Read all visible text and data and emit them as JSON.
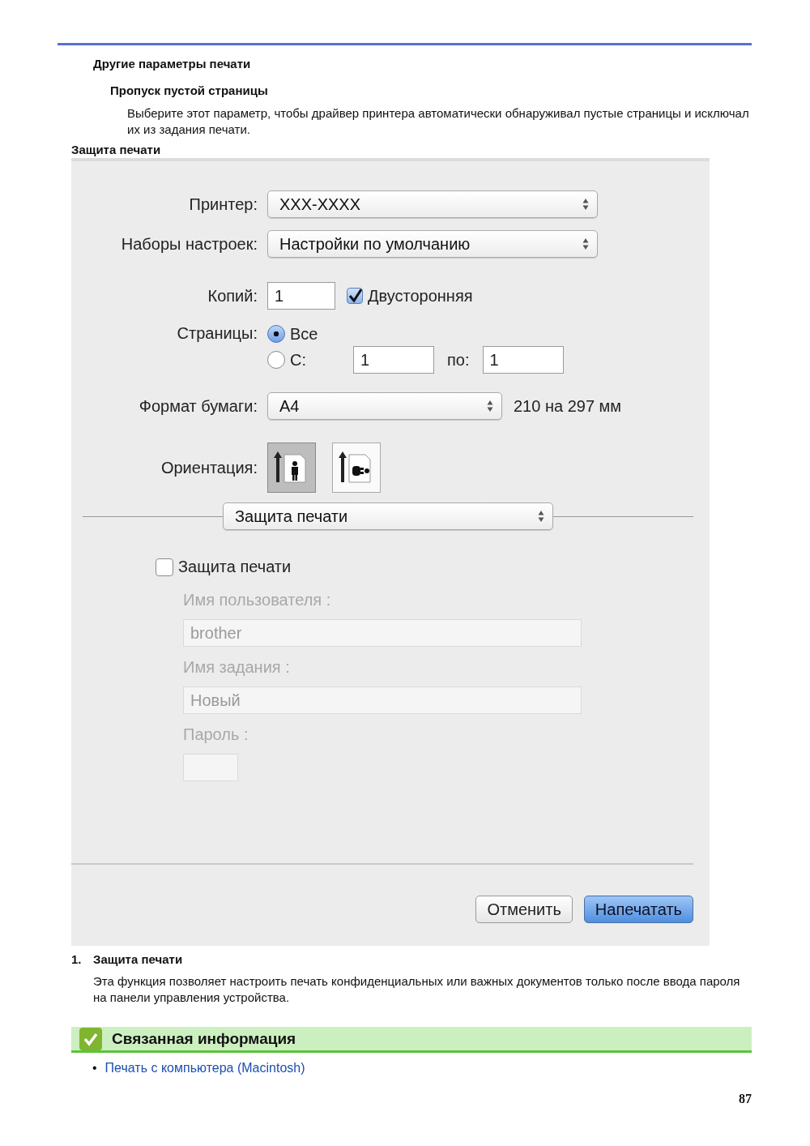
{
  "heading": "Другие параметры печати",
  "subheading": "Пропуск пустой страницы",
  "paragraph": "Выберите этот параметр, чтобы драйвер принтера автоматически обнаруживал пустые страницы и исключал их из задания печати.",
  "figure_title": "Защита печати",
  "dialog": {
    "printer": {
      "label": "Принтер:",
      "value": "XXX-XXXX"
    },
    "presets": {
      "label": "Наборы настроек:",
      "value": "Настройки по умолчанию"
    },
    "copies": {
      "label": "Копий:",
      "value": "1"
    },
    "two_sided": {
      "label": "Двусторонняя",
      "checked": true
    },
    "pages": {
      "label": "Страницы:",
      "options": [
        {
          "label": "Все",
          "selected": true
        },
        {
          "label": "С:",
          "selected": false
        }
      ],
      "from": "1",
      "to_label": "по:",
      "to": "1"
    },
    "paper_size": {
      "label": "Формат бумаги:",
      "value": "A4",
      "dimensions": "210 на 297 мм"
    },
    "orientation": {
      "label": "Ориентация:",
      "options": [
        {
          "kind": "portrait",
          "selected": true
        },
        {
          "kind": "landscape",
          "selected": false
        }
      ]
    },
    "panel_menu": {
      "value": "Защита печати"
    },
    "secure_print": {
      "label": "Защита печати",
      "checked": false
    },
    "fields": [
      {
        "kind": "text",
        "label": "Имя пользователя :",
        "value": "brother",
        "disabled": true
      },
      {
        "kind": "text",
        "label": "Имя задания :",
        "value": "Новый",
        "disabled": true
      },
      {
        "kind": "password",
        "label": "Пароль :",
        "disabled": true
      }
    ],
    "buttons": [
      {
        "label": "Отменить",
        "default": false
      },
      {
        "label": "Напечатать",
        "default": true
      }
    ]
  },
  "notes": [
    {
      "number": "1.",
      "title": "Защита печати",
      "text": "Эта функция позволяет настроить печать конфиденциальных или важных документов только после ввода пароля на панели управления устройства."
    }
  ],
  "related": {
    "title": "Связанная информация",
    "links": [
      {
        "bullet": "•",
        "label": "Печать с компьютера (Macintosh)"
      }
    ]
  },
  "page_number": "87"
}
